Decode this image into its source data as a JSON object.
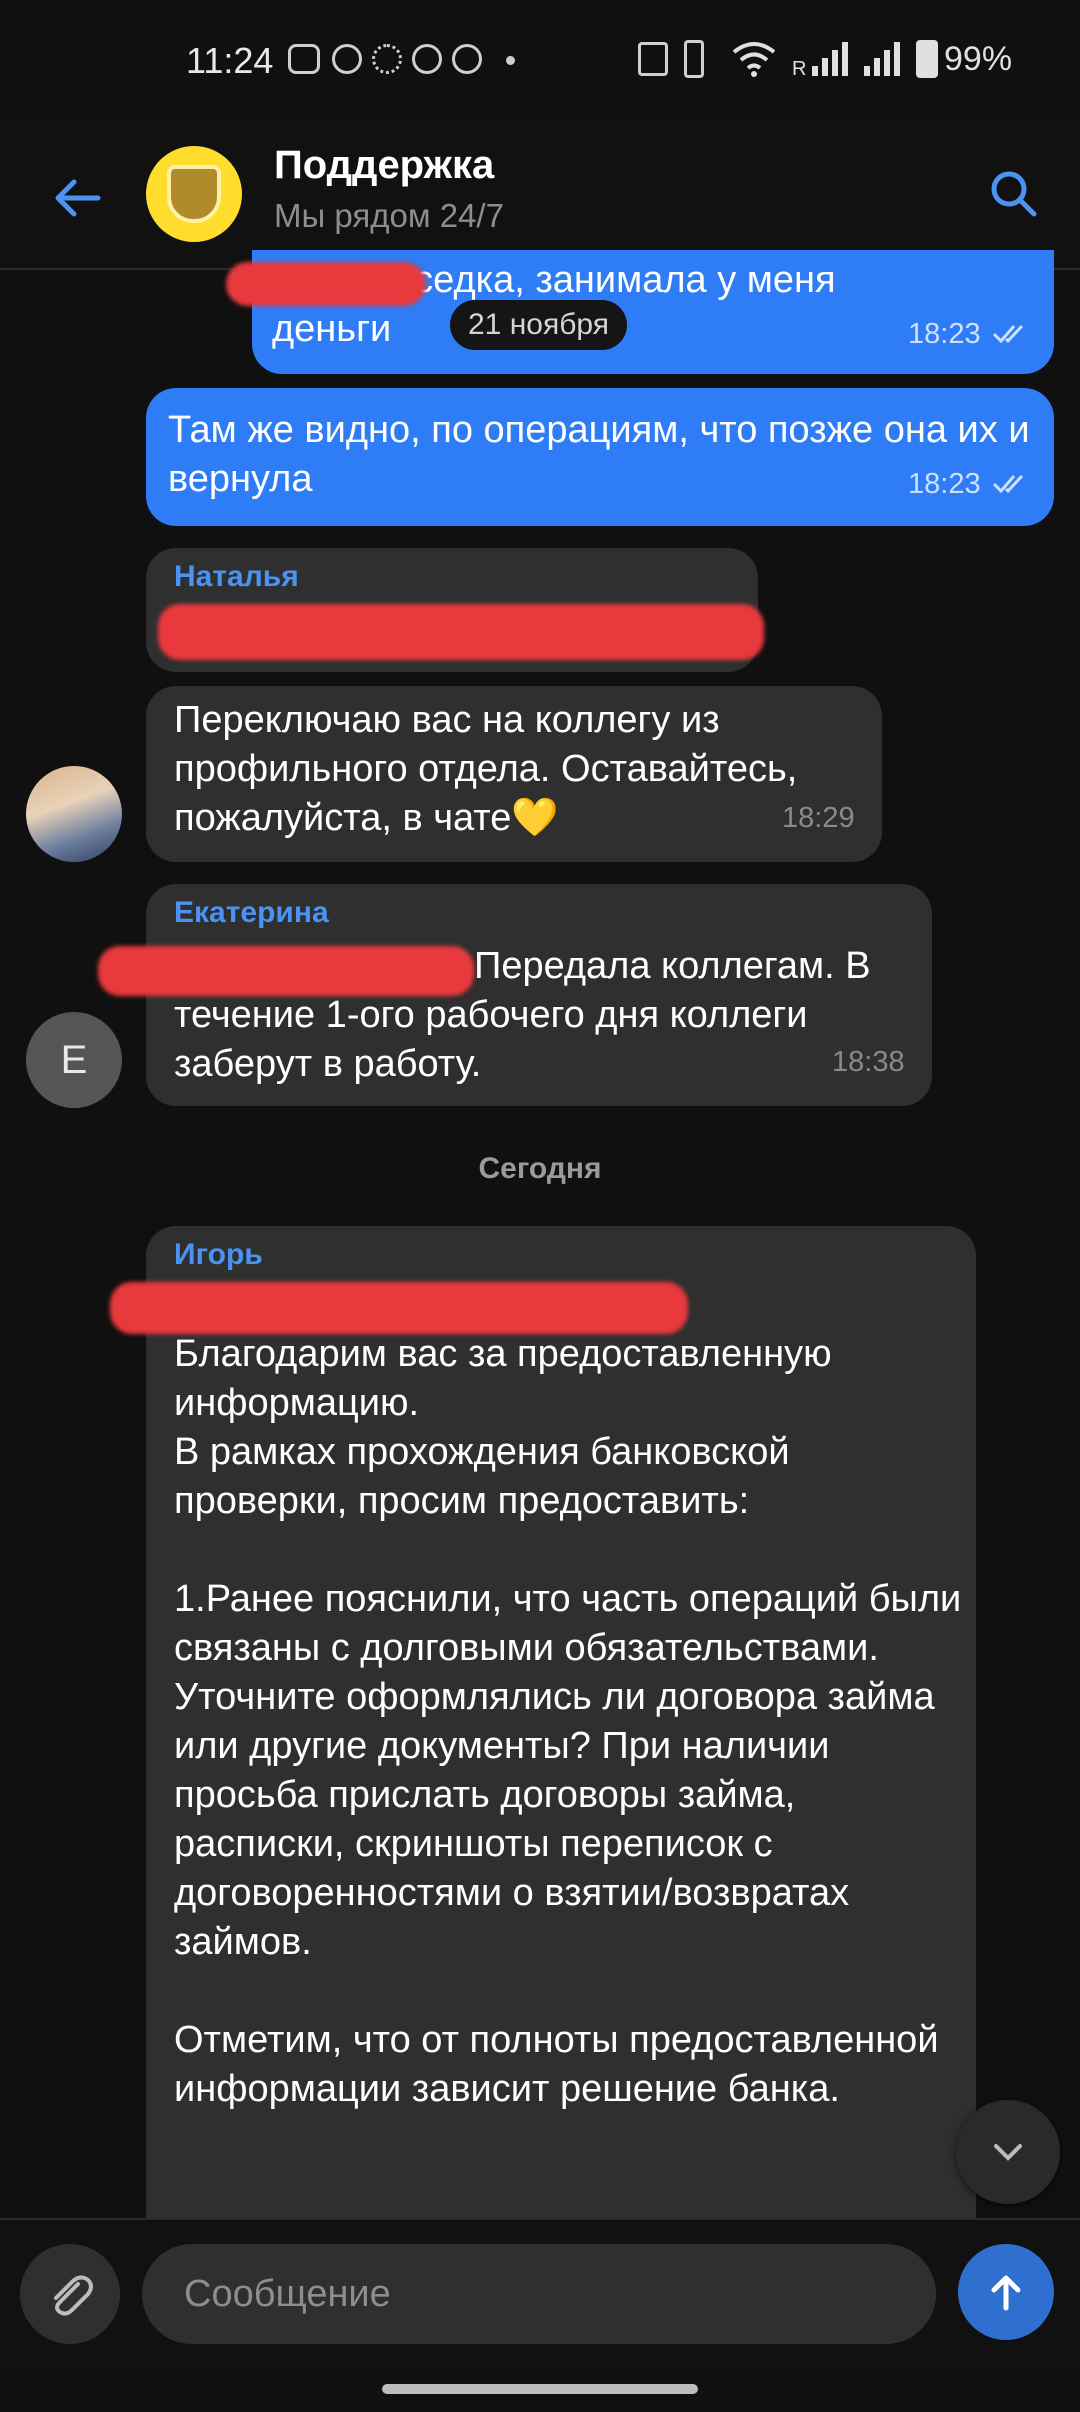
{
  "status_bar": {
    "time": "11:24",
    "battery": "99%",
    "signal_label": "R"
  },
  "header": {
    "title": "Поддержка",
    "subtitle": "Мы рядом 24/7",
    "icons": [
      "back-arrow-icon",
      "bank-logo",
      "search-icon"
    ]
  },
  "messages": [
    {
      "id": "m1",
      "type": "outgoing",
      "text": "- моя соседка, занимала у меня\nденьги",
      "time": "18:23",
      "status": "read"
    },
    {
      "id": "m2",
      "type": "outgoing",
      "text": "Там же видно, по операциям, что позже она их и вернула",
      "time": "18:23",
      "status": "read"
    },
    {
      "id": "m3",
      "type": "incoming",
      "sender": "Наталья",
      "text": "",
      "redacted": true
    },
    {
      "id": "m4",
      "type": "incoming",
      "text": "Переключаю вас на коллегу из профильного отдела. Оставайтесь, пожалуйста, в чате💛",
      "time": "18:29"
    },
    {
      "id": "m5",
      "type": "incoming",
      "sender": "Екатерина",
      "text": "Передала коллегам. В течение 1-ого рабочего дня коллеги заберут в работу.",
      "time": "18:38",
      "avatar_letter": "Е"
    },
    {
      "id": "m6",
      "type": "incoming",
      "sender": "Игорь",
      "text": "Благодарим вас за предоставленную информацию.\nВ рамках прохождения банковской проверки, просим предоставить:\n\n1.Ранее пояснили, что часть операций были связаны с долговыми обязательствами. Уточните оформлялись ли договора займа или другие документы? При наличии просьба прислать договоры займа, расписки, скриншоты переписок с договоренностями о взятии/возвратах займов.\n\nОтметим, что от полноты предоставленной информации зависит решение банка."
    }
  ],
  "floating_date": "21 ноября",
  "date_separator": "Сегодня",
  "composer": {
    "placeholder": "Сообщение"
  },
  "colors": {
    "outgoing": "#2e7cf6",
    "incoming": "#2f2f2f",
    "background": "#101010",
    "sender_name": "#4b93f2",
    "redaction": "#e8393d"
  }
}
